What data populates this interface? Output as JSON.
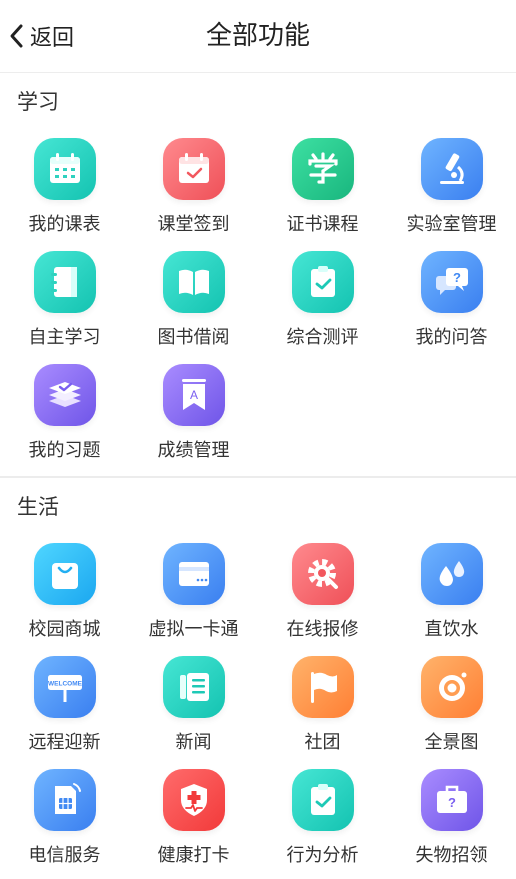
{
  "header": {
    "back_label": "返回",
    "title": "全部功能"
  },
  "colors": {
    "teal": "#1ec9b6",
    "red": "#f2575e",
    "green": "#1fbf85",
    "blue": "#4189f3",
    "purple": "#7a5ff0",
    "orange": "#ff8a3d"
  },
  "sections": [
    {
      "title": "学习",
      "items": [
        {
          "label": "我的课表",
          "icon": "calendar-icon"
        },
        {
          "label": "课堂签到",
          "icon": "calendar-check-icon"
        },
        {
          "label": "证书课程",
          "icon": "xue-character-icon"
        },
        {
          "label": "实验室管理",
          "icon": "microscope-icon"
        },
        {
          "label": "自主学习",
          "icon": "notebook-icon"
        },
        {
          "label": "图书借阅",
          "icon": "open-book-icon"
        },
        {
          "label": "综合测评",
          "icon": "clipboard-check-icon"
        },
        {
          "label": "我的问答",
          "icon": "question-chat-icon"
        },
        {
          "label": "我的习题",
          "icon": "layers-check-icon"
        },
        {
          "label": "成绩管理",
          "icon": "grade-bookmark-icon"
        }
      ]
    },
    {
      "title": "生活",
      "items": [
        {
          "label": "校园商城",
          "icon": "shopping-bag-icon"
        },
        {
          "label": "虚拟一卡通",
          "icon": "card-icon"
        },
        {
          "label": "在线报修",
          "icon": "repair-gear-icon"
        },
        {
          "label": "直饮水",
          "icon": "water-drops-icon"
        },
        {
          "label": "远程迎新",
          "icon": "welcome-sign-icon",
          "sign_text": "WELCOME"
        },
        {
          "label": "新闻",
          "icon": "news-icon"
        },
        {
          "label": "社团",
          "icon": "flag-icon"
        },
        {
          "label": "全景图",
          "icon": "panorama-camera-icon"
        },
        {
          "label": "电信服务",
          "icon": "sim-card-icon"
        },
        {
          "label": "健康打卡",
          "icon": "health-shield-icon"
        },
        {
          "label": "行为分析",
          "icon": "clipboard-check-icon"
        },
        {
          "label": "失物招领",
          "icon": "lost-box-icon"
        }
      ]
    }
  ]
}
